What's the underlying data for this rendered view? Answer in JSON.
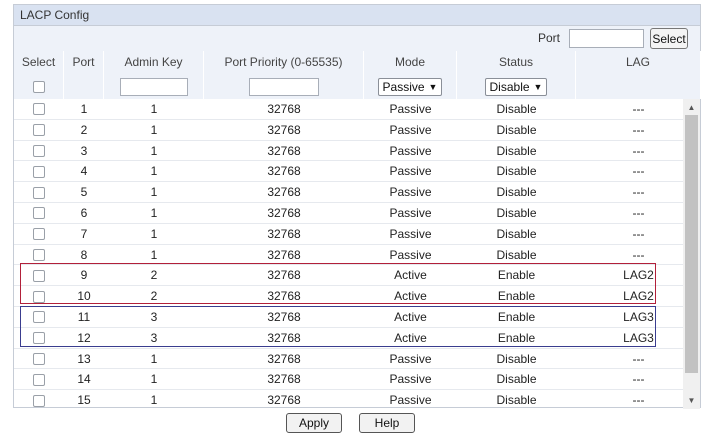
{
  "panel": {
    "title": "LACP Config"
  },
  "port_filter": {
    "label": "Port",
    "value": "",
    "button_label": "Select"
  },
  "columns": {
    "select": "Select",
    "port": "Port",
    "admin_key": "Admin Key",
    "port_priority": "Port Priority (0-65535)",
    "mode": "Mode",
    "status": "Status",
    "lag": "LAG"
  },
  "filters": {
    "admin_key_value": "",
    "port_priority_value": "",
    "mode_selected": "Passive",
    "status_selected": "Disable"
  },
  "rows": [
    {
      "port": "1",
      "admin_key": "1",
      "priority": "32768",
      "mode": "Passive",
      "status": "Disable",
      "lag": "---"
    },
    {
      "port": "2",
      "admin_key": "1",
      "priority": "32768",
      "mode": "Passive",
      "status": "Disable",
      "lag": "---"
    },
    {
      "port": "3",
      "admin_key": "1",
      "priority": "32768",
      "mode": "Passive",
      "status": "Disable",
      "lag": "---"
    },
    {
      "port": "4",
      "admin_key": "1",
      "priority": "32768",
      "mode": "Passive",
      "status": "Disable",
      "lag": "---"
    },
    {
      "port": "5",
      "admin_key": "1",
      "priority": "32768",
      "mode": "Passive",
      "status": "Disable",
      "lag": "---"
    },
    {
      "port": "6",
      "admin_key": "1",
      "priority": "32768",
      "mode": "Passive",
      "status": "Disable",
      "lag": "---"
    },
    {
      "port": "7",
      "admin_key": "1",
      "priority": "32768",
      "mode": "Passive",
      "status": "Disable",
      "lag": "---"
    },
    {
      "port": "8",
      "admin_key": "1",
      "priority": "32768",
      "mode": "Passive",
      "status": "Disable",
      "lag": "---"
    },
    {
      "port": "9",
      "admin_key": "2",
      "priority": "32768",
      "mode": "Active",
      "status": "Enable",
      "lag": "LAG2"
    },
    {
      "port": "10",
      "admin_key": "2",
      "priority": "32768",
      "mode": "Active",
      "status": "Enable",
      "lag": "LAG2"
    },
    {
      "port": "11",
      "admin_key": "3",
      "priority": "32768",
      "mode": "Active",
      "status": "Enable",
      "lag": "LAG3"
    },
    {
      "port": "12",
      "admin_key": "3",
      "priority": "32768",
      "mode": "Active",
      "status": "Enable",
      "lag": "LAG3"
    },
    {
      "port": "13",
      "admin_key": "1",
      "priority": "32768",
      "mode": "Passive",
      "status": "Disable",
      "lag": "---"
    },
    {
      "port": "14",
      "admin_key": "1",
      "priority": "32768",
      "mode": "Passive",
      "status": "Disable",
      "lag": "---"
    },
    {
      "port": "15",
      "admin_key": "1",
      "priority": "32768",
      "mode": "Passive",
      "status": "Disable",
      "lag": "---"
    }
  ],
  "buttons": {
    "apply": "Apply",
    "help": "Help"
  },
  "icons": {
    "dropdown": "chevron-down-icon",
    "scroll_up": "scroll-up-icon",
    "scroll_down": "scroll-down-icon"
  },
  "colors": {
    "header_bg": "#d9e2f1",
    "highlight_lag2": "#b2203a",
    "highlight_lag3": "#3a3d8f"
  }
}
